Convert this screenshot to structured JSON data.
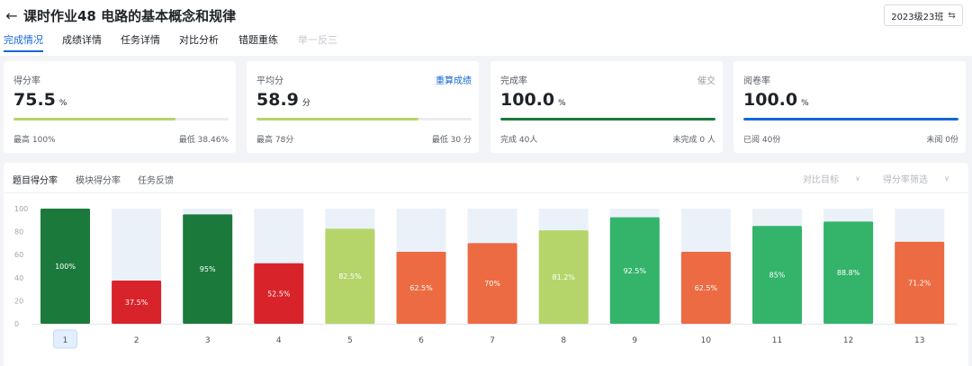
{
  "header": {
    "title": "课时作业48 电路的基本概念和规律",
    "class_selector": "2023级23班"
  },
  "tabs": [
    {
      "label": "完成情况",
      "state": "active"
    },
    {
      "label": "成绩详情",
      "state": "normal"
    },
    {
      "label": "任务详情",
      "state": "normal"
    },
    {
      "label": "对比分析",
      "state": "normal"
    },
    {
      "label": "错题重练",
      "state": "normal"
    },
    {
      "label": "举一反三",
      "state": "disabled"
    }
  ],
  "cards": [
    {
      "title": "得分率",
      "link": "",
      "value": "75.5",
      "unit": "%",
      "progress": 0.755,
      "bar_color": "#b5d56a",
      "foot_left": "最高 100%",
      "foot_right": "最低 38.46%"
    },
    {
      "title": "平均分",
      "link": "重算成绩",
      "value": "58.9",
      "unit": "分",
      "progress": 0.755,
      "bar_color": "#b5d56a",
      "foot_left": "最高 78分",
      "foot_right": "最低 30 分"
    },
    {
      "title": "完成率",
      "link": "催交",
      "value": "100.0",
      "unit": "%",
      "progress": 1.0,
      "bar_color": "#1b7a3b",
      "foot_left": "完成 40人",
      "foot_right": "未完成 0 人"
    },
    {
      "title": "阅卷率",
      "link": "",
      "value": "100.0",
      "unit": "%",
      "progress": 1.0,
      "bar_color": "#1468d8",
      "foot_left": "已阅 40份",
      "foot_right": "未阅 0份"
    }
  ],
  "chart_panel": {
    "subtabs": [
      {
        "label": "题目得分率",
        "active": true
      },
      {
        "label": "模块得分率",
        "active": false
      },
      {
        "label": "任务反馈",
        "active": false
      }
    ],
    "filters": [
      {
        "label": "对比目标"
      },
      {
        "label": "得分率筛选"
      }
    ]
  },
  "chart_data": {
    "type": "bar",
    "categories": [
      "1",
      "2",
      "3",
      "4",
      "5",
      "6",
      "7",
      "8",
      "9",
      "10",
      "11",
      "12",
      "13"
    ],
    "values": [
      100,
      37.5,
      95,
      52.5,
      82.5,
      62.5,
      70,
      81.2,
      92.5,
      62.5,
      85,
      88.8,
      71.2
    ],
    "data_labels": [
      "100%",
      "37.5%",
      "95%",
      "52.5%",
      "82.5%",
      "62.5%",
      "70%",
      "81.2%",
      "92.5%",
      "62.5%",
      "85%",
      "88.8%",
      "71.2%"
    ],
    "bar_colors": [
      "#1b7a3b",
      "#d9232a",
      "#1b7a3b",
      "#d9232a",
      "#b5d56a",
      "#ec6b42",
      "#ec6b42",
      "#b5d56a",
      "#34b36b",
      "#ec6b42",
      "#34b36b",
      "#34b36b",
      "#ec6b42"
    ],
    "background_bar_color": "#eaf1f9",
    "yticks": [
      0,
      20,
      40,
      60,
      80,
      100
    ],
    "ylim": [
      0,
      100
    ],
    "selected_category": "1",
    "grid": false
  }
}
